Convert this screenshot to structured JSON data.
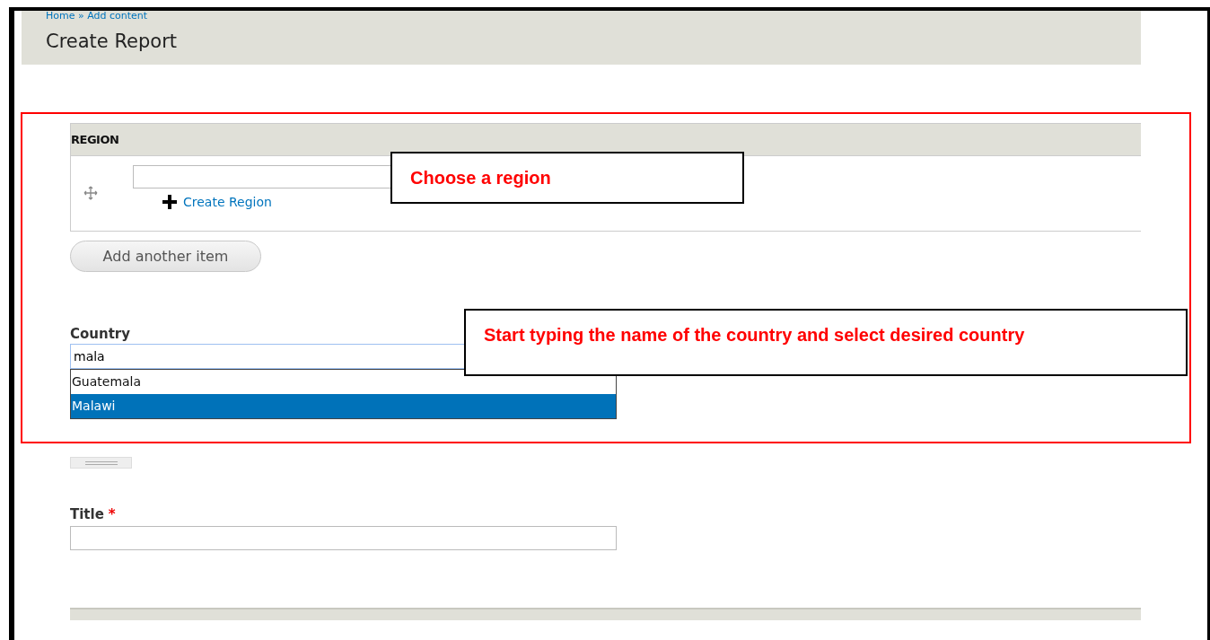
{
  "page": {
    "breadcrumb": "Home » Add content",
    "title": "Create Report"
  },
  "region_field": {
    "label": "REGION",
    "create_link": "Create Region",
    "add_button": "Add another item"
  },
  "country_field": {
    "label": "Country",
    "value": "mala",
    "suggestions": [
      {
        "label": "Guatemala",
        "selected": false
      },
      {
        "label": "Malawi",
        "selected": true
      }
    ]
  },
  "title_field": {
    "label": "Title",
    "required": true,
    "required_mark": "*"
  },
  "annotations": [
    {
      "text": "Choose a region"
    },
    {
      "text": "Start typing the name of the country and select desired country"
    }
  ]
}
